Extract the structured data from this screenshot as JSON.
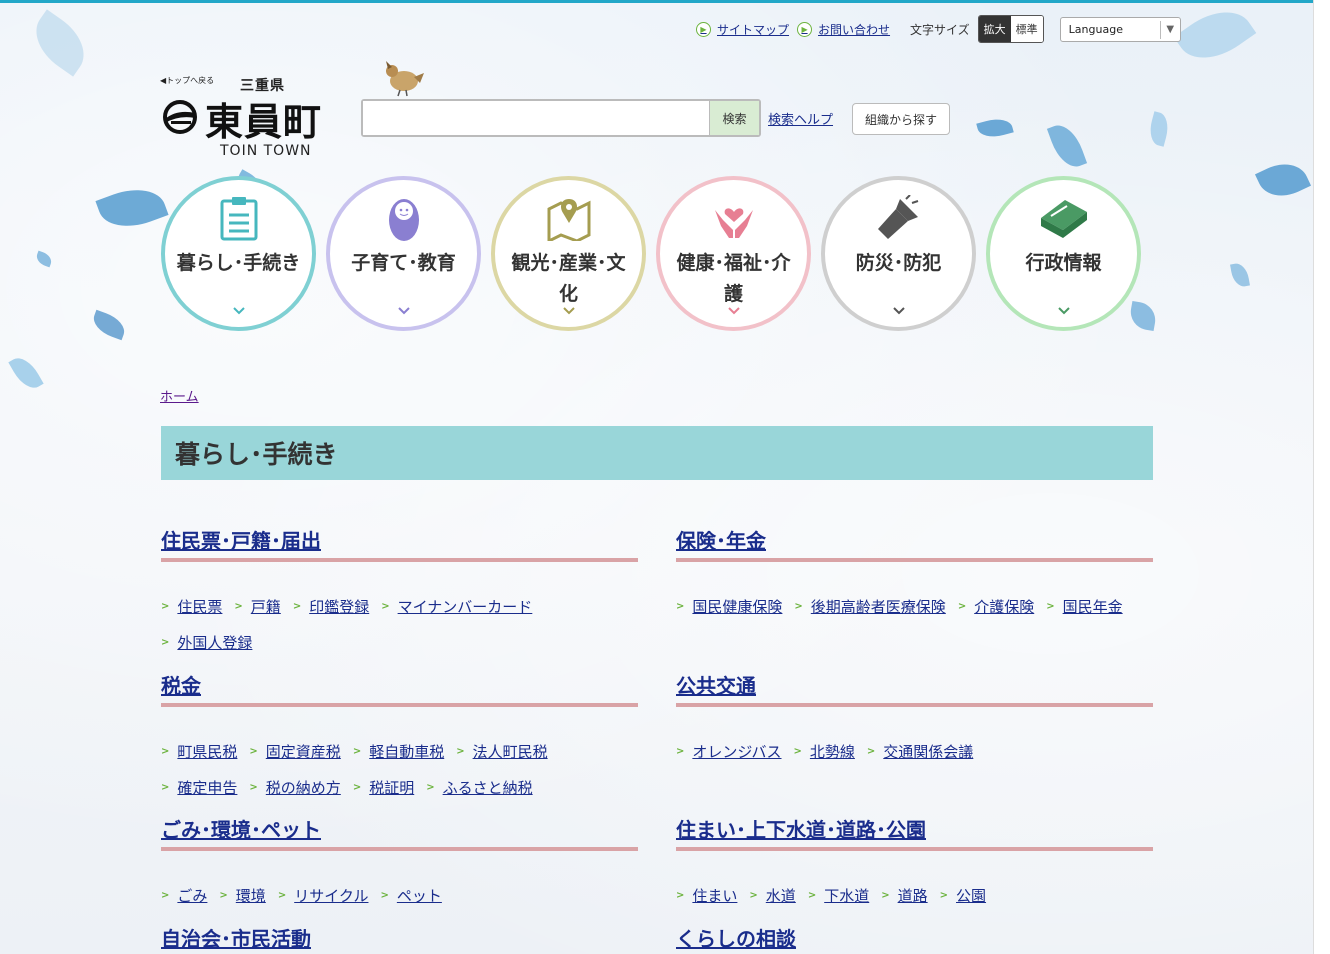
{
  "util": {
    "sitemap": "サイトマップ",
    "contact": "お問い合わせ",
    "font_size_label": "文字サイズ",
    "font_big": "拡大",
    "font_std": "標準",
    "language": "Language"
  },
  "logo": {
    "back_to_top": "◀トップへ戻る",
    "prefecture": "三重県",
    "town_name": "東員町",
    "town_en": "TOIN TOWN"
  },
  "search": {
    "button": "検索",
    "help": "検索ヘルプ",
    "org": "組織から探す",
    "value": ""
  },
  "categories": [
    {
      "label": "暮らし･手続き",
      "icon": "clipboard-icon",
      "color": "#7fd0d3"
    },
    {
      "label": "子育て･教育",
      "icon": "baby-icon",
      "color": "#b9b2e6"
    },
    {
      "label": "観光･産業･文化",
      "icon": "map-pin-icon",
      "color": "#d8d49a"
    },
    {
      "label": "健康･福祉･介護",
      "icon": "hands-heart-icon",
      "color": "#f0b9c2"
    },
    {
      "label": "防災･防犯",
      "icon": "flashlight-icon",
      "color": "#c9c9c9"
    },
    {
      "label": "行政情報",
      "icon": "book-icon",
      "color": "#a4e0a9"
    }
  ],
  "breadcrumb": "ホーム",
  "page_title": "暮らし･手続き",
  "sections": [
    {
      "title": "住民票･戸籍･届出",
      "links": [
        "住民票",
        "戸籍",
        "印鑑登録",
        "マイナンバーカード",
        "外国人登録"
      ]
    },
    {
      "title": "保険･年金",
      "links": [
        "国民健康保険",
        "後期高齢者医療保険",
        "介護保険",
        "国民年金"
      ]
    },
    {
      "title": "税金",
      "links": [
        "町県民税",
        "固定資産税",
        "軽自動車税",
        "法人町民税",
        "確定申告",
        "税の納め方",
        "税証明",
        "ふるさと納税"
      ]
    },
    {
      "title": "公共交通",
      "links": [
        "オレンジバス",
        "北勢線",
        "交通関係会議"
      ]
    },
    {
      "title": "ごみ･環境･ペット",
      "links": [
        "ごみ",
        "環境",
        "リサイクル",
        "ペット"
      ]
    },
    {
      "title": "住まい･上下水道･道路･公園",
      "links": [
        "住まい",
        "水道",
        "下水道",
        "道路",
        "公園"
      ]
    },
    {
      "title": "自治会･市民活動",
      "links": []
    },
    {
      "title": "くらしの相談",
      "links": []
    }
  ],
  "colors": {
    "accent_bar": "#22a7c8",
    "title_bg": "#99d6d9",
    "link": "#1a2d8c",
    "underline": "#d9a3a6",
    "chevron": "#6cb33e"
  }
}
